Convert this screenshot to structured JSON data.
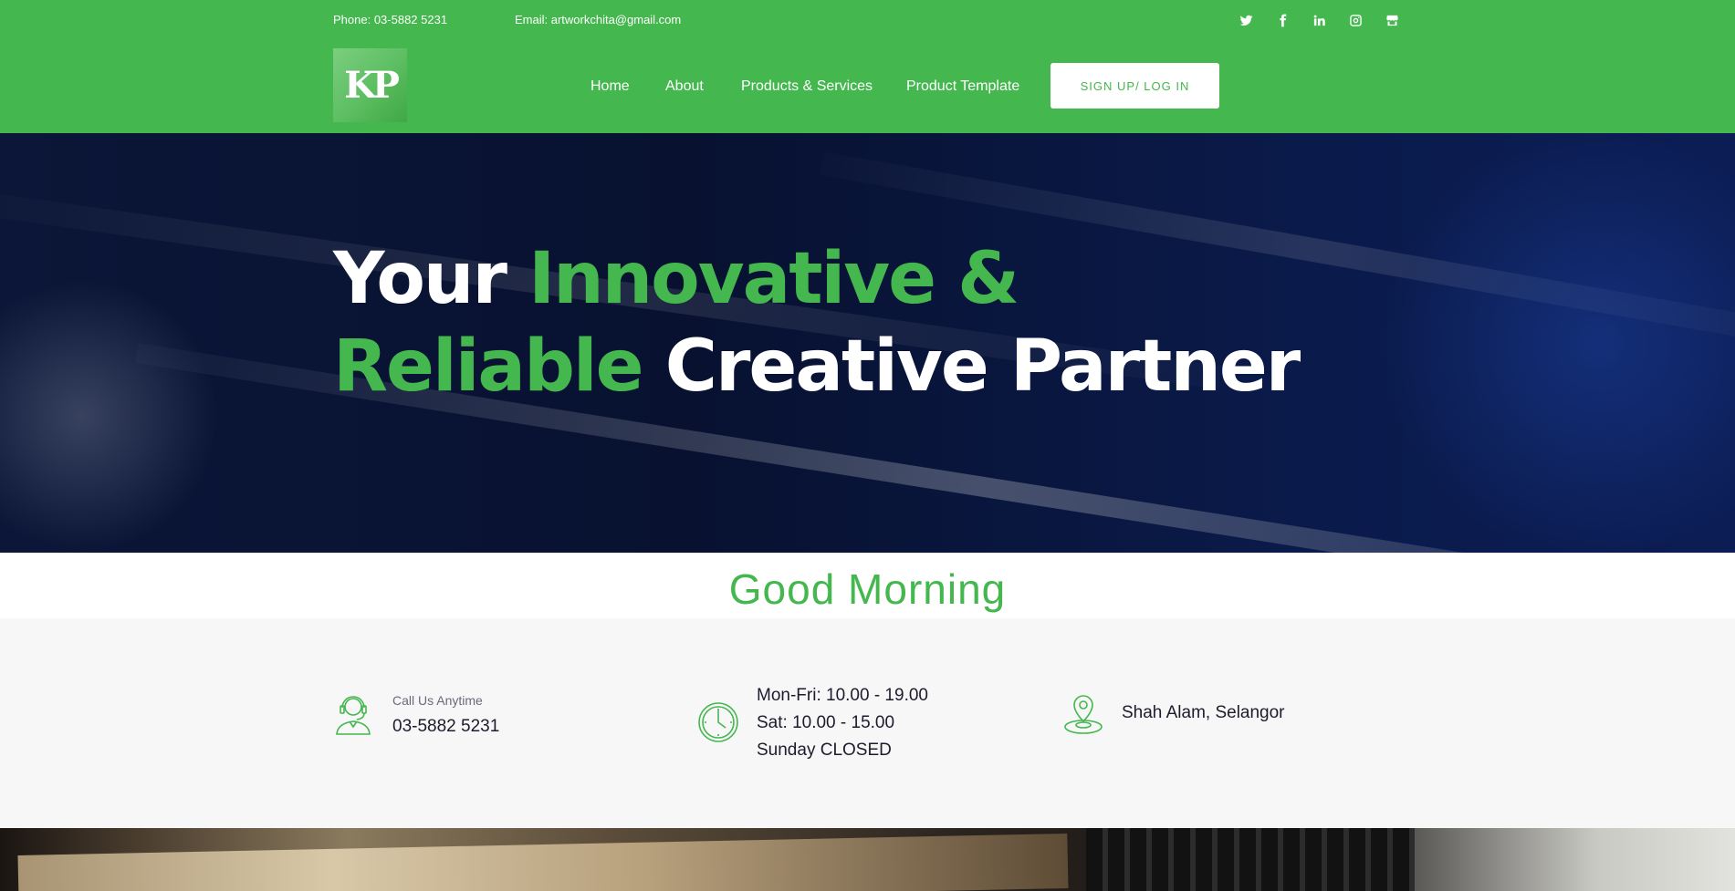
{
  "topbar": {
    "phone": "Phone: 03-5882 5231",
    "email": "Email: artworkchita@gmail.com",
    "socials": [
      "twitter-icon",
      "facebook-icon",
      "linkedin-icon",
      "instagram-icon",
      "store-icon"
    ]
  },
  "logo": {
    "text": "KP"
  },
  "nav": {
    "items": [
      "Home",
      "About",
      "Products & Services",
      "Product Template"
    ],
    "signup_label": "SIGN UP/ LOG IN"
  },
  "hero": {
    "line1_white": "Your ",
    "line1_green": "Innovative &",
    "line2_green": "Reliable",
    "line2_white": " Creative Partner"
  },
  "greeting": "Good Morning",
  "info": {
    "call_label": "Call Us Anytime",
    "call_number": "03-5882 5231",
    "hours": [
      "Mon-Fri: 10.00 - 19.00",
      "Sat: 10.00 - 15.00",
      "Sunday CLOSED"
    ],
    "location": "Shah Alam, Selangor"
  },
  "colors": {
    "brand_green": "#44b74e",
    "hero_navy": "#081130",
    "info_bg": "#f7f7f7"
  }
}
